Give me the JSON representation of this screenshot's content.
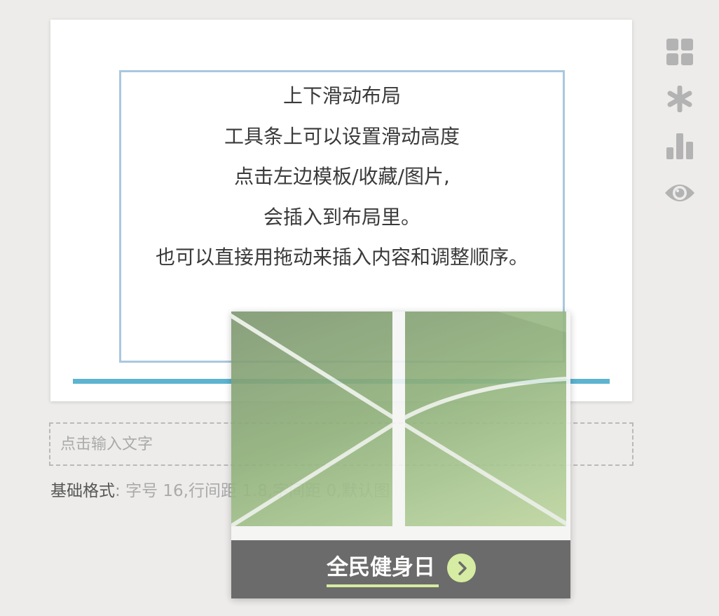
{
  "editor": {
    "slide_text_lines": [
      "上下滑动布局",
      "工具条上可以设置滑动高度",
      "点击左边模板/收藏/图片,",
      "会插入到布局里。",
      "也可以直接用拖动来插入内容和调整顺序。"
    ]
  },
  "text_input": {
    "placeholder": "点击输入文字",
    "value": ""
  },
  "format": {
    "label": "基础格式",
    "separator": ":",
    "value": "字号 16,行间距 1.8,字间距 0,默认图"
  },
  "toolbar": {
    "icons": [
      "grid-icon",
      "asterisk-icon",
      "bar-chart-icon",
      "eye-icon"
    ],
    "icon_color": "#b3b3b3"
  },
  "drag_preview": {
    "banner_title": "全民健身日",
    "arrow_icon": "chevron-right-icon",
    "accent_color": "#d4ec9b",
    "banner_color": "#5e5e5e"
  },
  "colors": {
    "background": "#edecea",
    "slide_border": "#a9c8df",
    "slider_line": "#5cb4d0"
  }
}
